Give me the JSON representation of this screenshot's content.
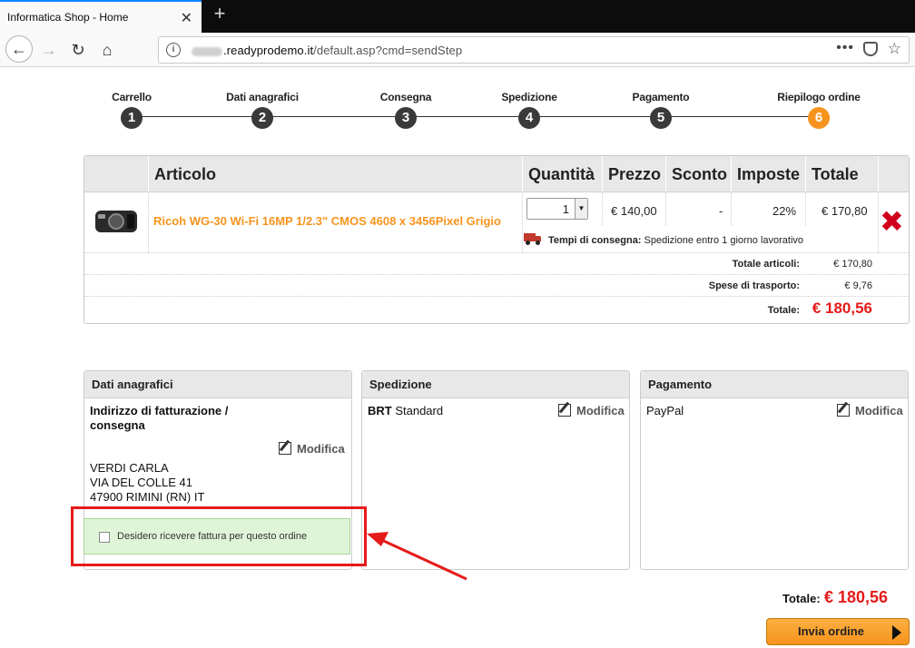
{
  "browser": {
    "tab_title": "Informatica Shop - Home",
    "tab_close": "✕",
    "new_tab": "+",
    "url_host": ".readyprodemo.it",
    "url_path": "/default.asp?cmd=sendStep",
    "url_more": "•••",
    "bookmark_star": "☆"
  },
  "steps": [
    {
      "label": "Carrello",
      "num": "1"
    },
    {
      "label": "Dati anagrafici",
      "num": "2"
    },
    {
      "label": "Consegna",
      "num": "3"
    },
    {
      "label": "Spedizione",
      "num": "4"
    },
    {
      "label": "Pagamento",
      "num": "5"
    },
    {
      "label": "Riepilogo ordine",
      "num": "6"
    }
  ],
  "cart": {
    "headers": {
      "article": "Articolo",
      "qty": "Quantità",
      "price": "Prezzo",
      "discount": "Sconto",
      "tax": "Imposte",
      "total": "Totale"
    },
    "item": {
      "name": "Ricoh WG-30 Wi-Fi 16MP 1/2.3\" CMOS 4608 x 3456Pixel Grigio",
      "qty": "1",
      "price": "€ 140,00",
      "discount": "-",
      "tax": "22%",
      "total": "€ 170,80",
      "delivery_label": "Tempi di consegna:",
      "delivery_text": " Spedizione entro 1 giorno lavorativo",
      "delete": "✖"
    },
    "summary": {
      "articles_label": "Totale articoli:",
      "articles_value": "€ 170,80",
      "shipping_label": "Spese di trasporto:",
      "shipping_value": "€ 9,76",
      "total_label": "Totale:",
      "total_value": "€ 180,56"
    }
  },
  "billing": {
    "title": "Dati anagrafici",
    "subtitle": "Indirizzo di fatturazione / consegna",
    "edit": "Modifica",
    "name": "VERDI CARLA",
    "street": "VIA DEL COLLE 41",
    "city": "47900 RIMINI (RN) IT",
    "invoice_label": "Desidero ricevere fattura per questo ordine",
    "invoice_checked": false
  },
  "shipping": {
    "title": "Spedizione",
    "carrier": "BRT",
    "service": " Standard",
    "edit": "Modifica"
  },
  "payment": {
    "title": "Pagamento",
    "method": "PayPal",
    "edit": "Modifica"
  },
  "footer": {
    "total_label": "Totale:",
    "total_value": "€ 180,56",
    "submit_label": "Invia ordine"
  },
  "colors": {
    "accent": "#f7941d",
    "highlight": "#e51a1a",
    "invoice_bg": "#dff5d8"
  }
}
